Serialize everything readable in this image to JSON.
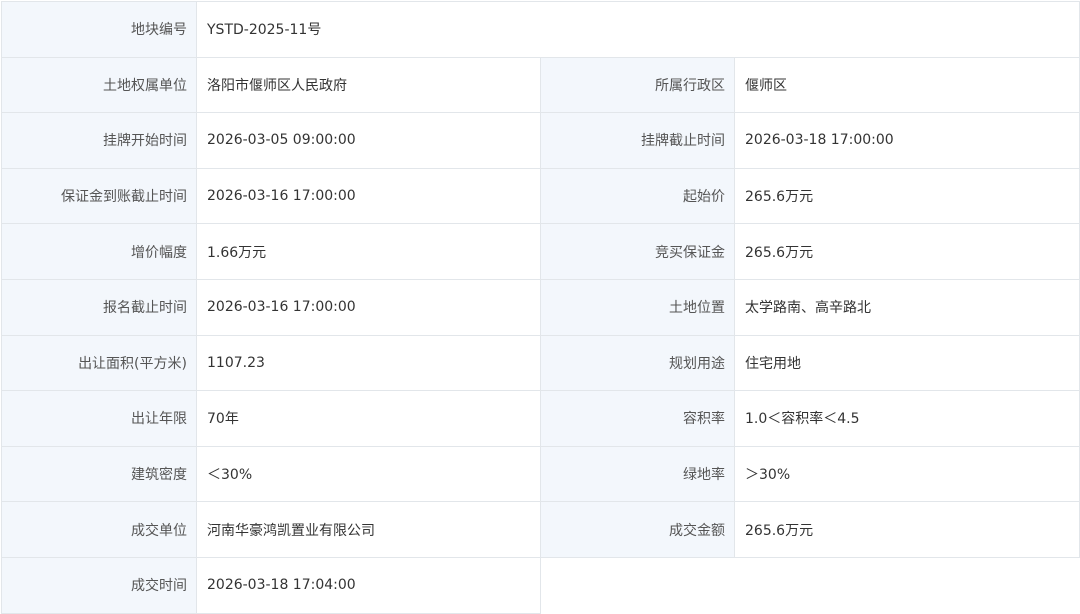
{
  "rows": [
    {
      "label": "地块编号",
      "value": "YSTD-2025-11号"
    },
    {
      "label": "土地权属单位",
      "value": "洛阳市偃师区人民政府",
      "label2": "所属行政区",
      "value2": "偃师区"
    },
    {
      "label": "挂牌开始时间",
      "value": "2026-03-05 09:00:00",
      "label2": "挂牌截止时间",
      "value2": "2026-03-18 17:00:00"
    },
    {
      "label": "保证金到账截止时间",
      "value": "2026-03-16 17:00:00",
      "label2": "起始价",
      "value2": "265.6万元"
    },
    {
      "label": "增价幅度",
      "value": "1.66万元",
      "label2": "竞买保证金",
      "value2": "265.6万元"
    },
    {
      "label": "报名截止时间",
      "value": "2026-03-16 17:00:00",
      "label2": "土地位置",
      "value2": "太学路南、高辛路北"
    },
    {
      "label": "出让面积(平方米)",
      "value": "1107.23",
      "label2": "规划用途",
      "value2": "住宅用地"
    },
    {
      "label": "出让年限",
      "value": "70年",
      "label2": "容积率",
      "value2": "1.0＜容积率＜4.5"
    },
    {
      "label": "建筑密度",
      "value": "＜30%",
      "label2": "绿地率",
      "value2": "＞30%"
    },
    {
      "label": "成交单位",
      "value": "河南华豪鸿凯置业有限公司",
      "label2": "成交金额",
      "value2": "265.6万元"
    },
    {
      "label": "成交时间",
      "value": "2026-03-18 17:04:00"
    }
  ]
}
